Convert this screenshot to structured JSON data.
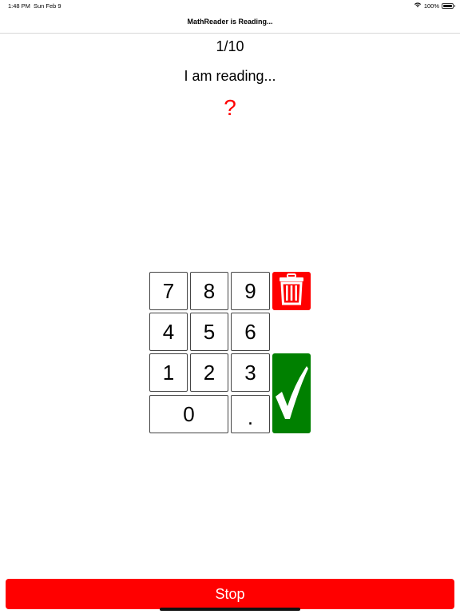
{
  "status_bar": {
    "time": "1:48 PM",
    "date": "Sun Feb 9",
    "battery": "100%",
    "wifi_icon": "wifi-icon",
    "battery_icon": "battery-icon"
  },
  "nav": {
    "title": "MathReader is Reading..."
  },
  "main": {
    "progress": "1/10",
    "status": "I am reading...",
    "answer": "?"
  },
  "keypad": {
    "k7": "7",
    "k8": "8",
    "k9": "9",
    "k4": "4",
    "k5": "5",
    "k6": "6",
    "k1": "1",
    "k2": "2",
    "k3": "3",
    "k0": "0",
    "kdot": ".",
    "delete_icon": "trash-icon",
    "submit_icon": "checkmark-icon"
  },
  "footer": {
    "stop_label": "Stop"
  },
  "colors": {
    "accent_red": "#ff0000",
    "submit_green": "#008000"
  }
}
